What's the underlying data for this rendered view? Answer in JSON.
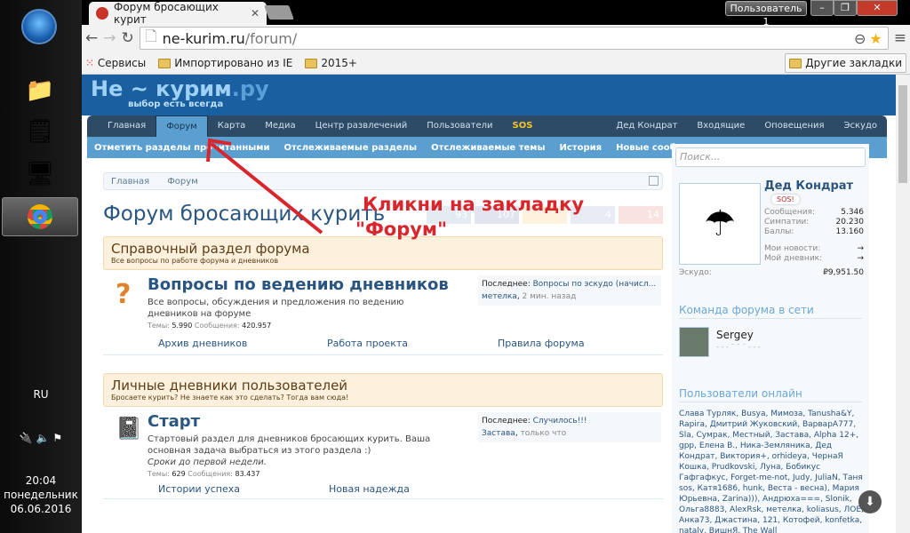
{
  "taskbar": {
    "lang": "RU",
    "time": "20:04",
    "day": "понедельник",
    "date": "06.06.2016"
  },
  "browser": {
    "tab_title": "Форум бросающих курит",
    "user": "Пользователь 1",
    "url_host": "ne-kurim.ru",
    "url_path": "/forum/",
    "bookmarks": [
      "Сервисы",
      "Импортировано из IE",
      "2015+"
    ],
    "other_bookmarks": "Другие закладки"
  },
  "site": {
    "logo_main": "Не ~ курим",
    "logo_tld": ".ру",
    "slogan": "выбор есть всегда",
    "nav": [
      "Главная",
      "Форум",
      "Карта",
      "Медиа",
      "Центр развлечений",
      "Пользователи",
      "SOS"
    ],
    "nav_right": [
      "Дед Кондрат",
      "Входящие",
      "Оповещения",
      "Эскудо"
    ],
    "subnav": [
      "Отметить разделы прочитанными",
      "Отслеживаемые разделы",
      "Отслеживаемые темы",
      "История",
      "Новые сообщения"
    ]
  },
  "breadcrumb": [
    "Главная",
    "Форум"
  ],
  "page_title": "Форум бросающих курить",
  "share": [
    {
      "icon": "vk",
      "count": "93",
      "color": "#4a76a8"
    },
    {
      "icon": "f",
      "count": "107",
      "color": "#3b5998"
    },
    {
      "icon": "y",
      "count": "",
      "color": "#f6a623"
    },
    {
      "icon": "ok",
      "count": "4",
      "color": "#5b7fb8"
    },
    {
      "icon": "G",
      "count": "14",
      "color": "#dd4b39"
    }
  ],
  "annotation": {
    "line1": "Кликни на закладку",
    "line2": "\"Форум\""
  },
  "categories": [
    {
      "title": "Справочный раздел форума",
      "desc": "Все вопросы по работе форума и дневников",
      "forum": {
        "title": "Вопросы по ведению дневников",
        "desc": "Все вопросы, обсуждения и предложения по ведению дневников на форуме",
        "desc2": "",
        "themes_label": "Темы:",
        "themes": "5.990",
        "posts_label": "Сообщения:",
        "posts": "420.957",
        "last_label": "Последнее:",
        "last_title": "Вопросы по эскудо (начисл...",
        "last_user": "метелка",
        "last_time": "2 мин. назад",
        "subforums": [
          "Архив дневников",
          "Работа проекта",
          "Правила форума"
        ]
      }
    },
    {
      "title": "Личные дневники пользователей",
      "desc": "Бросаете курить? Не знаете как это сделать? Тогда вам сюда!",
      "forum": {
        "title": "Старт",
        "desc": "Стартовый раздел для дневников бросающих курить. Ваша основная задача выбраться из этого раздела :)",
        "desc2": "Сроки до первой недели.",
        "themes_label": "Темы:",
        "themes": "629",
        "posts_label": "Сообщения:",
        "posts": "83.437",
        "last_label": "Последнее:",
        "last_title": "Случилось!!!",
        "last_user": "Застава",
        "last_time": "только что",
        "subforums": [
          "Истории успеха",
          "Новая надежда"
        ]
      }
    }
  ],
  "sidebar": {
    "search_placeholder": "Поиск...",
    "user": "Дед Кондрат",
    "badge": "SOS!",
    "stats": [
      {
        "label": "Сообщения:",
        "value": "5.346"
      },
      {
        "label": "Симпатии:",
        "value": "20.230"
      },
      {
        "label": "Баллы:",
        "value": "13.160"
      }
    ],
    "links": [
      {
        "label": "Мои новости:",
        "value": "→"
      },
      {
        "label": "Мой дневник:",
        "value": "→"
      }
    ],
    "escudo_label": "Эскудо:",
    "escudo": "₽9,951.50",
    "team_title": "Команда форума в сети",
    "team_member": "Sergey",
    "team_status": "- - - ¯ ¯ ¯ - - -",
    "online_title": "Пользователи онлайн",
    "online": "Слава Турляк, Busya, Мимоза, Tanusha&Y, Rapira, Дмитрий Жуковский, ВарварA777, Sla, Сумрак, Местный, Застава, Alpha 12+, gpp, Елена В., Ника-Земляника, Дед Кондрат, Виктория+, orhideya, ЧернаЯ Кошка, Prudkovski, Луна, Бобикус Гафгафкус, Forget-me-not, Judy, JuliaN, Таня sos, Катя1686, hunk, Веста - весна), Мария Юрьевна, Zarina))), Андрюха===, Slonik, Ольга8883, AlexRsk, метелка, koliasus, ЛОЕ, Анка73, Джастина, 121, Котофей, konfetka, nataly, ВишнЯ, The Wall"
  }
}
